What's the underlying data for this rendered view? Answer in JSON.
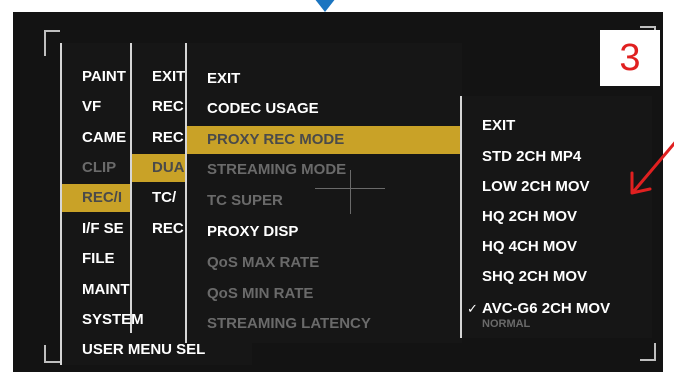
{
  "step_number": "3",
  "menu_level1": [
    {
      "label": "PAINT",
      "state": "normal"
    },
    {
      "label": "VF",
      "state": "normal"
    },
    {
      "label": "CAME",
      "state": "normal"
    },
    {
      "label": "CLIP",
      "state": "dim"
    },
    {
      "label": "REC/I",
      "state": "selected"
    },
    {
      "label": "I/F SE",
      "state": "normal"
    },
    {
      "label": "FILE",
      "state": "normal"
    },
    {
      "label": "MAINTENAN",
      "state": "normal"
    },
    {
      "label": "SYSTEM",
      "state": "normal"
    },
    {
      "label": "USER MENU SEL",
      "state": "normal"
    }
  ],
  "menu_level2": [
    {
      "label": "EXIT",
      "state": "normal"
    },
    {
      "label": "REC",
      "state": "normal"
    },
    {
      "label": "REC",
      "state": "normal"
    },
    {
      "label": "DUA",
      "state": "selected"
    },
    {
      "label": "TC/",
      "state": "normal"
    },
    {
      "label": "REC",
      "state": "normal"
    }
  ],
  "menu_level3": [
    {
      "label": "EXIT",
      "state": "normal"
    },
    {
      "label": "CODEC USAGE",
      "state": "normal"
    },
    {
      "label": "PROXY REC MODE",
      "state": "selected"
    },
    {
      "label": "STREAMING MODE",
      "state": "dim"
    },
    {
      "label": "TC SUPER",
      "state": "dim"
    },
    {
      "label": "PROXY DISP",
      "state": "normal"
    },
    {
      "label": "QoS MAX RATE",
      "state": "dim"
    },
    {
      "label": "QoS MIN RATE",
      "state": "dim"
    },
    {
      "label": "STREAMING LATENCY",
      "state": "dim"
    }
  ],
  "menu_level4": [
    {
      "label": "EXIT",
      "checked": false
    },
    {
      "label": "STD 2CH MP4",
      "checked": false
    },
    {
      "label": "LOW 2CH MOV",
      "checked": false
    },
    {
      "label": "HQ 2CH MOV",
      "checked": false
    },
    {
      "label": "HQ 4CH MOV",
      "checked": false
    },
    {
      "label": "SHQ 2CH MOV",
      "checked": false
    },
    {
      "label": "AVC-G6 2CH MOV",
      "checked": true
    }
  ],
  "ghost_text": "NORMAL",
  "check_glyph": "✓",
  "colors": {
    "selected_bg": "#c9a227",
    "annotation_red": "#e02020",
    "pointer_blue": "#1b75c0"
  }
}
